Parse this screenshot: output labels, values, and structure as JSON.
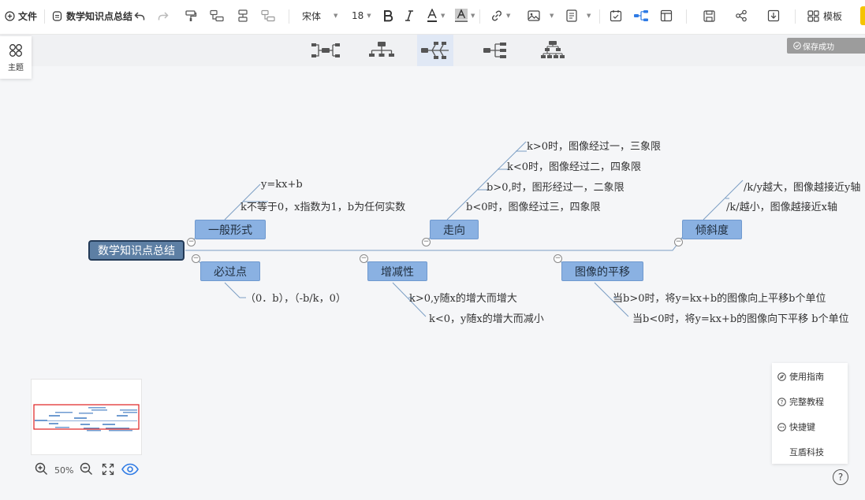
{
  "toolbar": {
    "file_label": "文件",
    "doc_title": "数学知识点总结",
    "font_family": "宋体",
    "font_size": "18",
    "template_label": "模板"
  },
  "side_panel": {
    "theme_label": "主题"
  },
  "status": {
    "save_status": "保存成功"
  },
  "mindmap": {
    "root": "数学知识点总结",
    "branches": [
      {
        "label": "一般形式",
        "items": [
          "y=kx+b",
          "k不等于0，x指数为1，b为任何实数"
        ]
      },
      {
        "label": "必过点",
        "items": [
          "（0．b），（-b/k，0）"
        ]
      },
      {
        "label": "增减性",
        "items": [
          "k>0,y随x的增大而增大",
          "k<0，y随x的增大而减小"
        ]
      },
      {
        "label": "走向",
        "items": [
          "k>0时，图像经过一，三象限",
          "k<0时，图像经过二，四象限",
          "b>0,时，图形经过一，二象限",
          "b<0时，图像经过三，四象限"
        ]
      },
      {
        "label": "图像的平移",
        "items": [
          "当b>0时，将y=kx+b的图像向上平移b个单位",
          "当b<0时，将y=kx+b的图像向下平移 b个单位"
        ]
      },
      {
        "label": "倾斜度",
        "items": [
          "/k/y越大，图像越接近y轴",
          "/k/越小，图像越接近x轴"
        ]
      }
    ]
  },
  "zoom": {
    "level": "50%"
  },
  "help_panel": {
    "guide": "使用指南",
    "tutorial": "完整教程",
    "shortcuts": "快捷键",
    "company": "互盾科技"
  },
  "colors": {
    "node_fill": "#8ab1e2",
    "root_fill": "#5d7fa4",
    "root_border": "#233a57",
    "accent": "#2f7be5",
    "line": "#7b9ec4"
  }
}
